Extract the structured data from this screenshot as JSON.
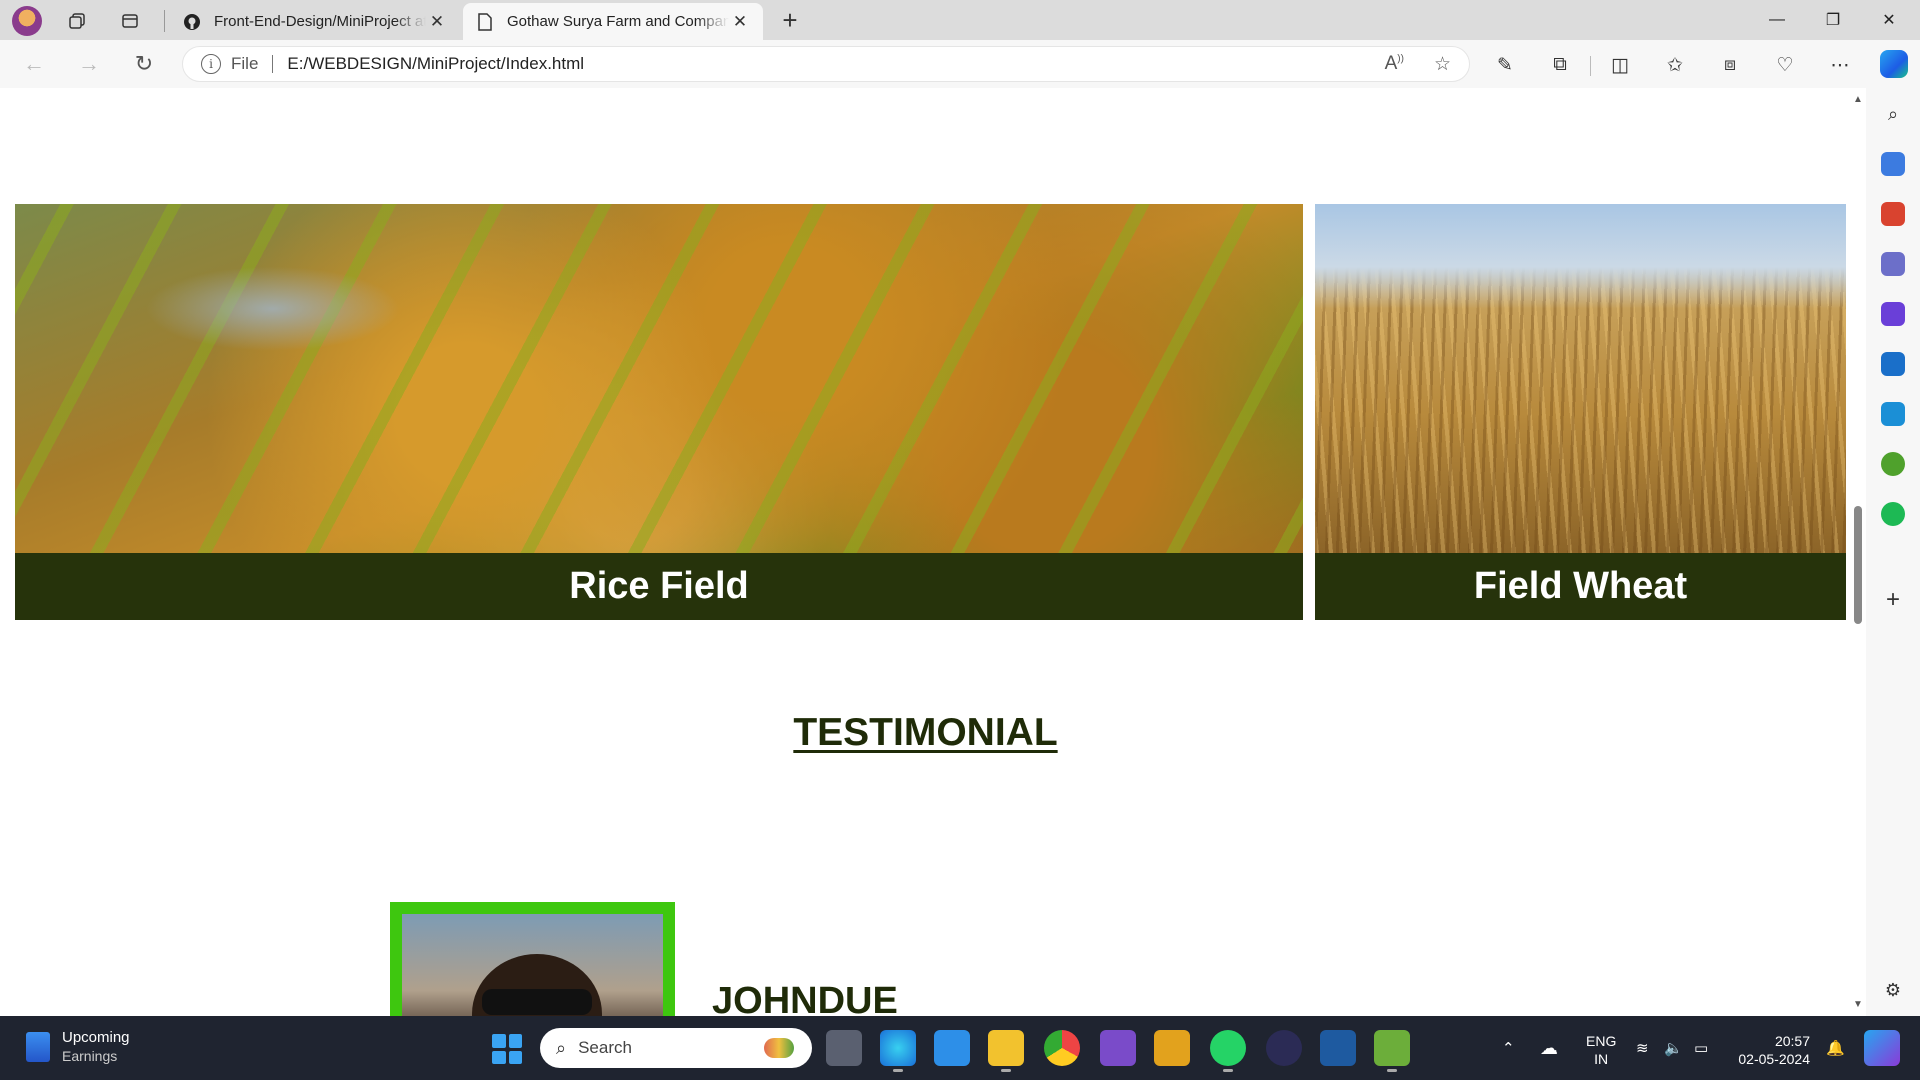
{
  "browser": {
    "tabs": [
      {
        "title": "Front-End-Design/MiniProject at",
        "icon": "github-icon",
        "active": false
      },
      {
        "title": "Gothaw Surya Farm and Compan",
        "icon": "page-icon",
        "active": true
      }
    ],
    "address": {
      "scheme": "File",
      "url": "E:/WEBDESIGN/MiniProject/Index.html"
    }
  },
  "page": {
    "cards": [
      {
        "caption": "Rice Field"
      },
      {
        "caption": "Field Wheat"
      }
    ],
    "testimonial": {
      "heading": "TESTIMONIAL",
      "name": "JOHNDUE"
    }
  },
  "taskbar": {
    "weather": {
      "line1": "Upcoming",
      "line2": "Earnings"
    },
    "search_label": "Search",
    "lang": {
      "line1": "ENG",
      "line2": "IN"
    },
    "clock": {
      "time": "20:57",
      "date": "02-05-2024"
    }
  },
  "colors": {
    "caption_bg": "#26330b",
    "heading_text": "#1f2b08",
    "avatar_border": "#3ec70f"
  }
}
